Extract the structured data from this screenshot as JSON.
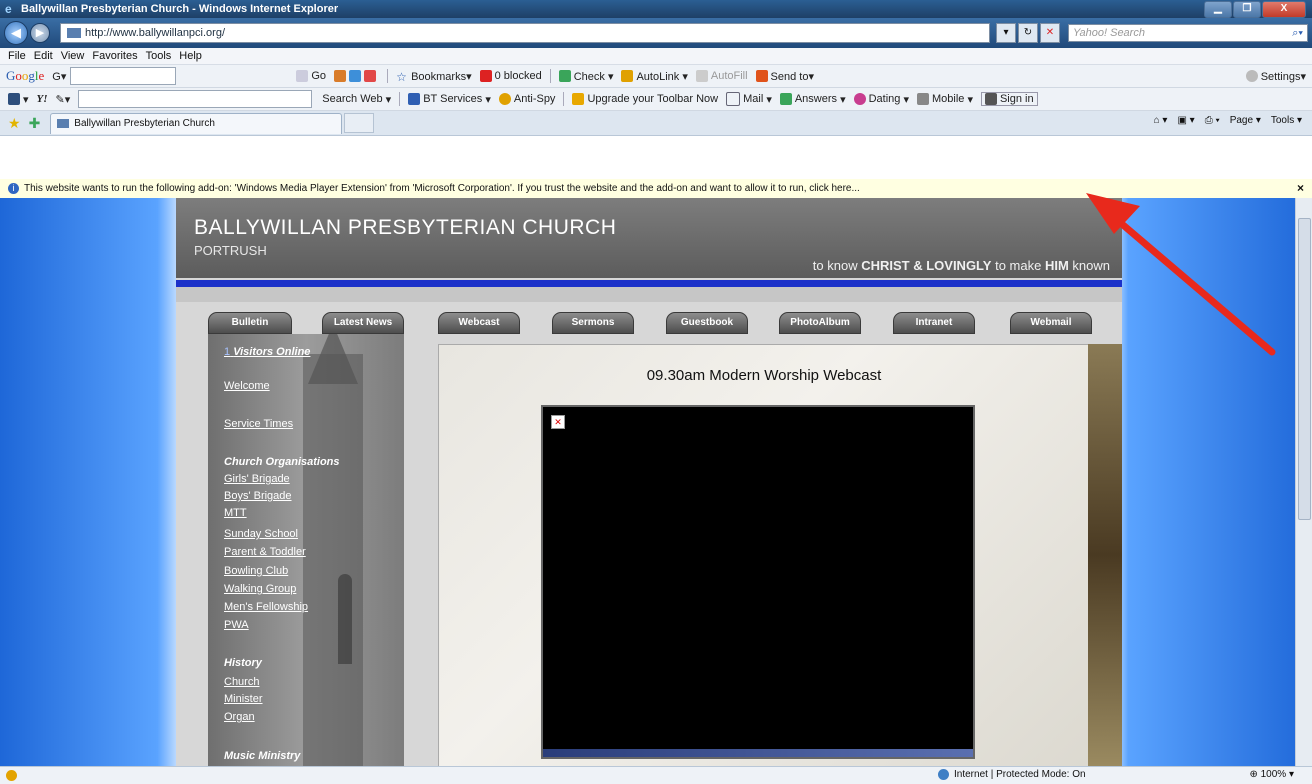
{
  "window": {
    "title": "Ballywillan Presbyterian Church - Windows Internet Explorer",
    "buttons": [
      "▁",
      "❐",
      "X"
    ]
  },
  "address": {
    "url": "http://www.ballywillanpci.org/",
    "search_placeholder": "Yahoo! Search"
  },
  "menu": [
    "File",
    "Edit",
    "View",
    "Favorites",
    "Tools",
    "Help"
  ],
  "google_toolbar": {
    "logo": [
      "G",
      "o",
      "o",
      "g",
      "l",
      "e"
    ],
    "g_label": "G▾",
    "go": "Go",
    "bookmarks": "Bookmarks▾",
    "blocked": "0 blocked",
    "check": "Check ▾",
    "autolink": "AutoLink ▾",
    "autofill": "AutoFill",
    "send": "Send to▾",
    "settings": "Settings▾"
  },
  "yahoo_toolbar": {
    "logo": "Y!",
    "search_web": "Search Web",
    "bt_services": "BT Services",
    "anti_spy": "Anti-Spy",
    "upgrade": "Upgrade your Toolbar Now",
    "mail": "Mail",
    "answers": "Answers",
    "dating": "Dating",
    "mobile": "Mobile",
    "sign_in": "Sign in"
  },
  "tabs": {
    "active": "Ballywillan Presbyterian Church",
    "tools": [
      "Page ▾",
      "Tools ▾"
    ]
  },
  "infobar": {
    "message": "This website wants to run the following add-on: 'Windows Media Player Extension' from 'Microsoft Corporation'. If you trust the website and the add-on and want to allow it to run, click here...",
    "close": "×"
  },
  "site": {
    "name": "BALLYWILLAN PRESBYTERIAN CHURCH",
    "town": "PORTRUSH",
    "motto_pre": "to know ",
    "motto_christ": "CHRIST & LOVINGLY",
    "motto_mid": " to make ",
    "motto_him": "HIM",
    "motto_end": " known",
    "nav": [
      "Bulletin",
      "Latest News",
      "Webcast",
      "Sermons",
      "Guestbook",
      "PhotoAlbum",
      "Intranet",
      "Webmail"
    ],
    "sidebar": {
      "visitors_count": "1",
      "visitors_label": "Visitors Online",
      "welcome": "Welcome",
      "service_times": "Service Times",
      "orgs_heading": "Church Organisations",
      "orgs": [
        "Girls' Brigade",
        "Boys' Brigade",
        "MTT",
        "Sunday School",
        "Parent & Toddler",
        "Bowling Club",
        "Walking Group",
        "Men's Fellowship",
        "PWA"
      ],
      "history_heading": "History",
      "history": [
        "Church",
        "Minister",
        "Organ"
      ],
      "music_heading": "Music Ministry"
    },
    "webcast_title": "09.30am Modern Worship Webcast"
  },
  "status": {
    "zone": "Internet | Protected Mode: On",
    "zoom": "100%"
  },
  "colors": {
    "arrow": "#e8291c",
    "accent_blue": "#1b31c9"
  }
}
